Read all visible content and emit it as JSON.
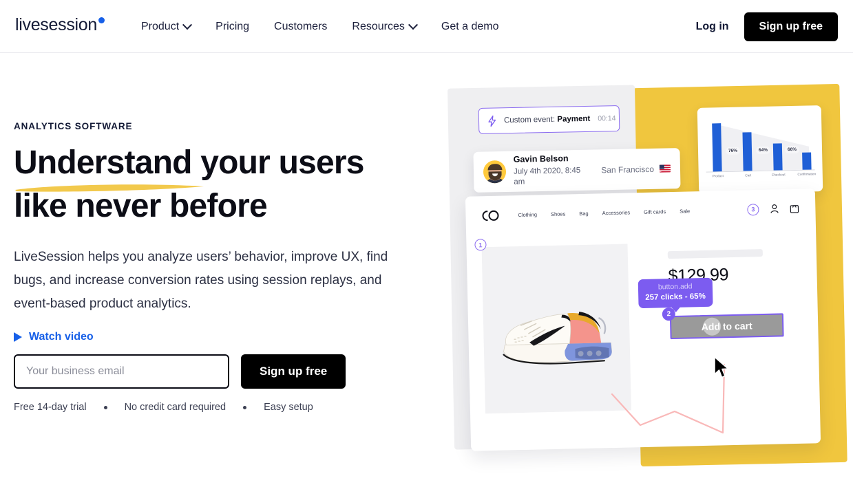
{
  "nav": {
    "logo_text": "livesession",
    "links": [
      {
        "label": "Product",
        "has_dropdown": true
      },
      {
        "label": "Pricing",
        "has_dropdown": false
      },
      {
        "label": "Customers",
        "has_dropdown": false
      },
      {
        "label": "Resources",
        "has_dropdown": true
      },
      {
        "label": "Get a demo",
        "has_dropdown": false
      }
    ],
    "login_label": "Log in",
    "signup_label": "Sign up free"
  },
  "hero": {
    "eyebrow": "ANALYTICS SOFTWARE",
    "headline_part1": "Understand",
    "headline_part2": " your users",
    "headline_line2": "like never before",
    "subhead": "LiveSession helps you analyze users’ behavior, improve UX, find bugs, and increase conversion rates using session replays, and event-based product analytics.",
    "watch_video_label": "Watch video",
    "email_placeholder": "Your business email",
    "email_value": "",
    "cta_label": "Sign up free",
    "perks": [
      "Free 14-day trial",
      "No credit card required",
      "Easy setup"
    ]
  },
  "illustration": {
    "event_pill": {
      "prefix": "Custom event:",
      "event_name": "Payment",
      "time": "00:14"
    },
    "user_card": {
      "name": "Gavin Belson",
      "date": "July 4th 2020, 8:45 am",
      "city": "San Francisco"
    },
    "shop": {
      "nav_links": [
        "Clothing",
        "Shoes",
        "Bag",
        "Accessories",
        "Gift cards",
        "Sale"
      ],
      "cart_badge": "3",
      "price": "$129.99",
      "add_to_cart_label": "Add to cart",
      "step_1": "1",
      "step_2": "2"
    },
    "tooltip": {
      "selector": "button.add",
      "stats": "257 clicks - 65%"
    }
  },
  "chart_data": {
    "type": "bar",
    "title": "",
    "categories": [
      "Product",
      "Cart",
      "Checkout",
      "Confirmation"
    ],
    "values": [
      100,
      76,
      49,
      31
    ],
    "labels": [
      "76%",
      "64%",
      "66%"
    ],
    "xlabel": "",
    "ylabel": "",
    "ylim": [
      0,
      100
    ],
    "grid": false,
    "legend": "none",
    "bar_color": "#1f5fd6"
  },
  "colors": {
    "accent_blue": "#1760e8",
    "bar_blue": "#1f5fd6",
    "purple": "#7c5cf0",
    "yellow": "#F0C63E",
    "underline_yellow": "#F2C94C",
    "dark": "#0c0d16",
    "path_pink": "#f9b8b8"
  }
}
